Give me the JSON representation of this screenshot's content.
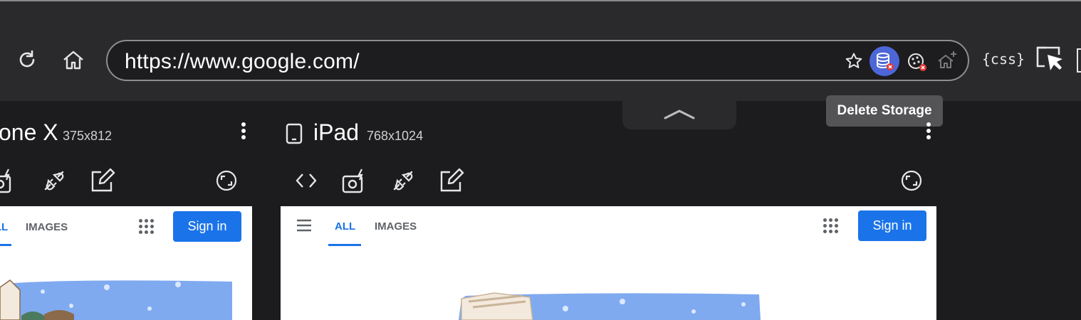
{
  "browser": {
    "url": "https://www.google.com/",
    "css_label": "{css}",
    "tooltip": "Delete Storage"
  },
  "devices": [
    {
      "name": "one X",
      "resolution": "375x812"
    },
    {
      "name": "iPad",
      "resolution": "768x1024"
    }
  ],
  "google": {
    "tabs": [
      "ALL",
      "IMAGES"
    ],
    "sign_in": "Sign in"
  },
  "colors": {
    "accent": "#1a73e8",
    "extension_active": "#4d67d8",
    "toolbar_bg": "#2a2a2d",
    "app_bg": "#1c1c1e"
  }
}
